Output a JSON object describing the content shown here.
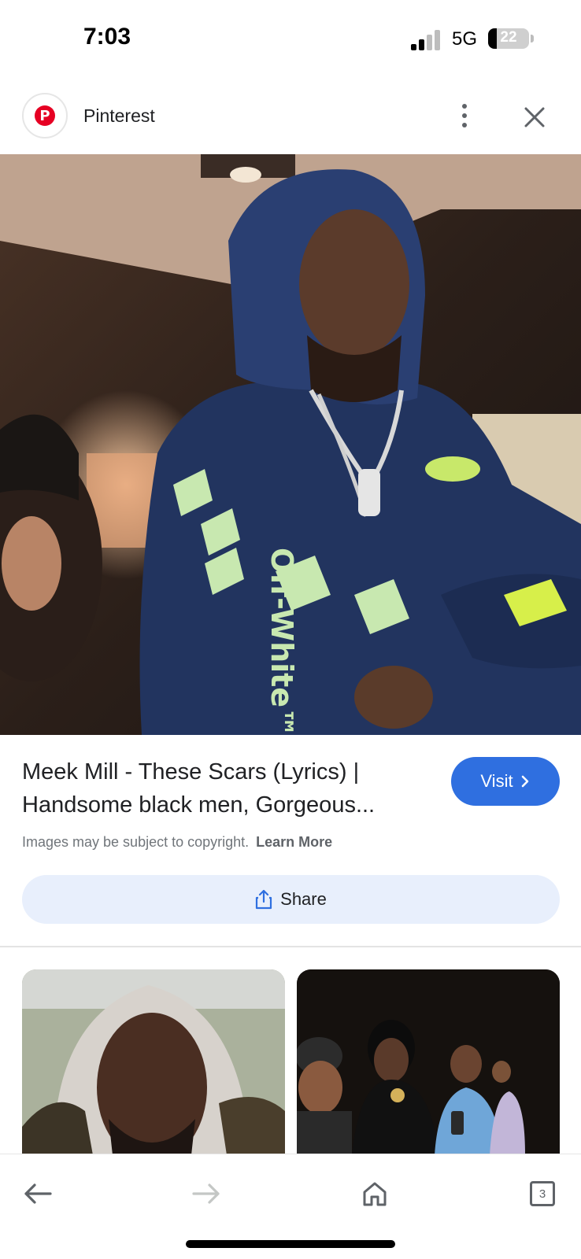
{
  "status_bar": {
    "time": "7:03",
    "network": "5G",
    "battery_percent": "22",
    "battery_level": 0.22
  },
  "source": {
    "name": "Pinterest",
    "logo_icon": "pinterest-logo-icon",
    "brand_color": "#e60023"
  },
  "result": {
    "title": "Meek Mill - These Scars (Lyrics) | Handsome black men, Gorgeous...",
    "visit_label": "Visit",
    "copyright_text": "Images may be subject to copyright.",
    "learn_more_label": "Learn More",
    "share_label": "Share",
    "accent_color": "#2f6fe0"
  },
  "hero_image": {
    "print_text": "Off-White™"
  },
  "bottom_nav": {
    "tab_count": "3",
    "icons": [
      "back-arrow-icon",
      "forward-arrow-icon",
      "home-icon",
      "tabs-icon"
    ]
  }
}
